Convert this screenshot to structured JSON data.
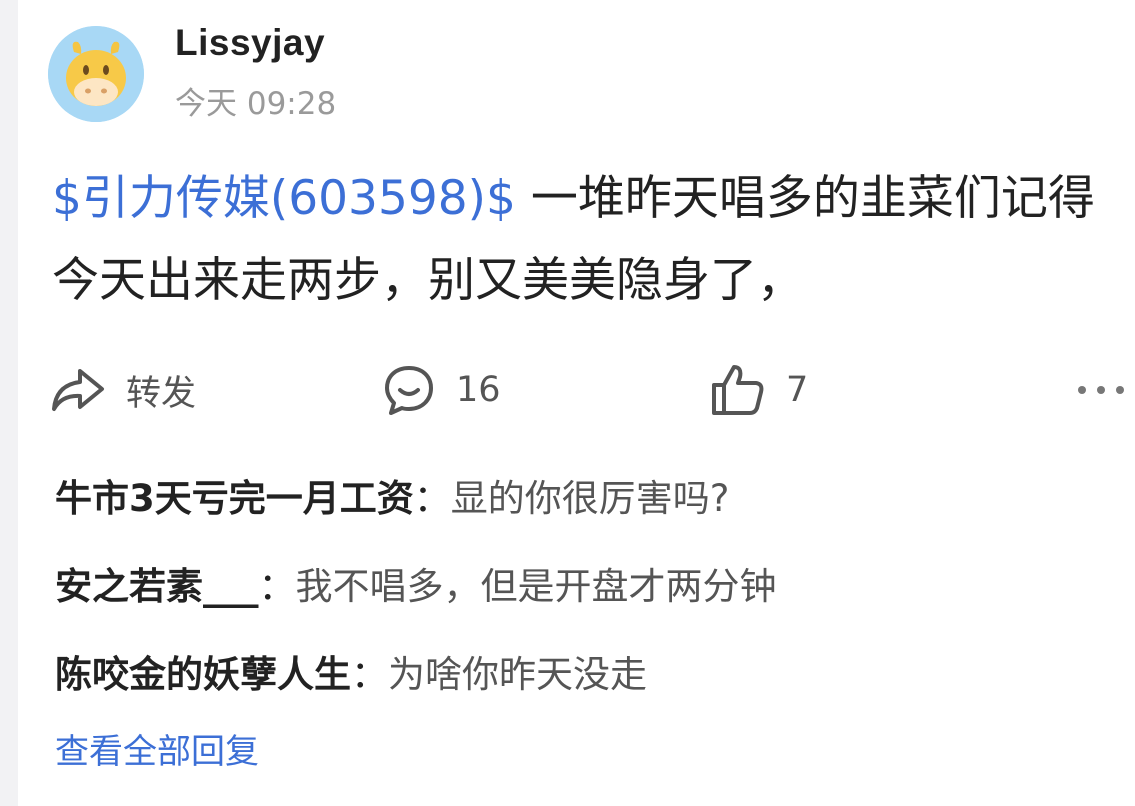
{
  "post": {
    "author": "Lissyjay",
    "time": "今天 09:28",
    "stock_tag": "$引力传媒(603598)$",
    "text": " 一堆昨天唱多的韭菜们记得今天出来走两步，别又美美隐身了，"
  },
  "actions": {
    "repost_label": "转发",
    "comment_count": "16",
    "like_count": "7"
  },
  "icons": {
    "repost": "share-arrow-icon",
    "comment": "comment-bubble-icon",
    "like": "thumbs-up-icon",
    "more": "more-dots-icon",
    "avatar": "cow-avatar-icon"
  },
  "comments": [
    {
      "author": "牛市3天亏完一月工资",
      "sep": "：",
      "text": "显的你很厉害吗?"
    },
    {
      "author": "安之若素___",
      "sep": "：",
      "text": "我不唱多，但是开盘才两分钟"
    },
    {
      "author": "陈咬金的妖孽人生",
      "sep": "：",
      "text": "为啥你昨天没走"
    }
  ],
  "view_all_replies": "查看全部回复",
  "colors": {
    "link": "#3c6fd6",
    "avatar_bg": "#a8d8f5",
    "muted": "#9a9a9a"
  }
}
